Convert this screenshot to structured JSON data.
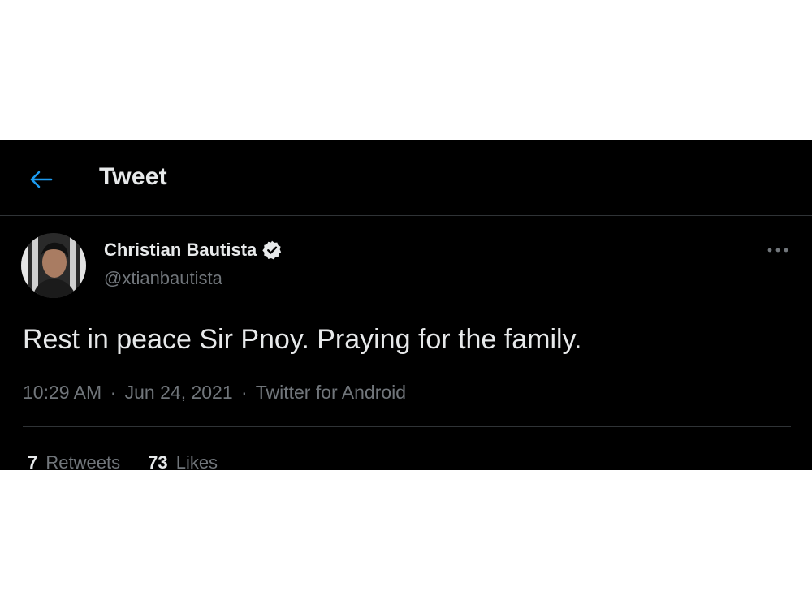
{
  "header": {
    "title": "Tweet",
    "back_icon": "arrow-left-icon",
    "accent_color": "#1d9bf0"
  },
  "author": {
    "display_name": "Christian Bautista",
    "handle": "@xtianbautista",
    "verified_icon": "verified-badge-icon"
  },
  "tweet": {
    "text": "Rest in peace Sir Pnoy. Praying for the family.",
    "time": "10:29 AM",
    "date": "Jun 24, 2021",
    "source": "Twitter for Android",
    "separator": "·"
  },
  "stats": {
    "retweets_count": "7",
    "retweets_label": "Retweets",
    "likes_count": "73",
    "likes_label": "Likes"
  },
  "more_icon": "more-horizontal-icon"
}
